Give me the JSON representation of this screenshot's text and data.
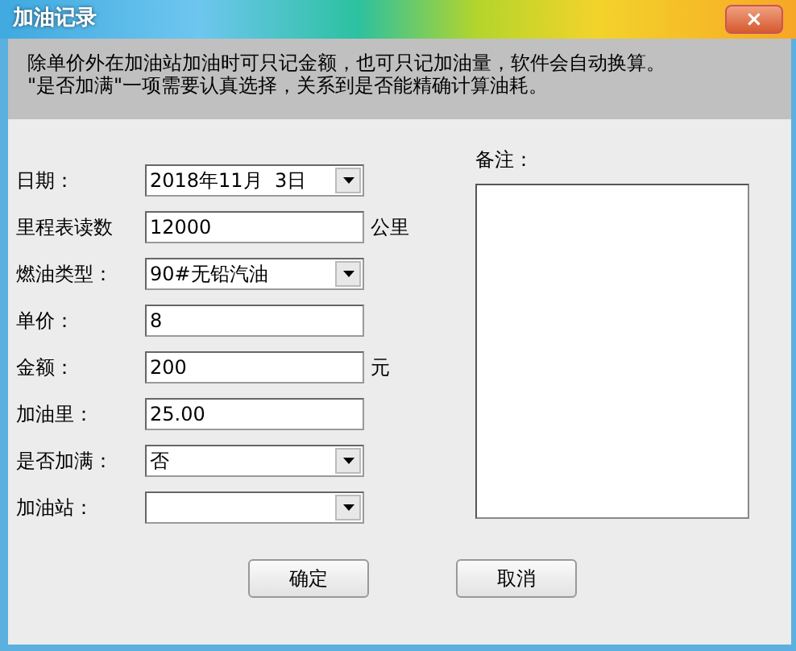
{
  "window": {
    "title": "加油记录",
    "close": "×"
  },
  "info": [
    "除单价外在加油站加油时可只记金额，也可只记加油量，软件会自动换算。",
    "\"是否加满\"一项需要认真选择，关系到是否能精确计算油耗。"
  ],
  "fields": [
    {
      "label": "日期：",
      "kind": "select",
      "value": "2018年11月  3日"
    },
    {
      "label": "里程表读数",
      "kind": "input",
      "value": "12000",
      "unit": "公里"
    },
    {
      "label": "燃油类型：",
      "kind": "select",
      "value": "90#无铅汽油"
    },
    {
      "label": "单价：",
      "kind": "input",
      "value": "8"
    },
    {
      "label": "金额：",
      "kind": "input",
      "value": "200",
      "unit": "元"
    },
    {
      "label": "加油里：",
      "kind": "input",
      "value": "25.00"
    },
    {
      "label": "是否加满：",
      "kind": "select",
      "value": "否"
    },
    {
      "label": "加油站：",
      "kind": "select"
    }
  ],
  "notes": {
    "label": "备注："
  },
  "buttons": [
    "确定",
    "取消"
  ]
}
